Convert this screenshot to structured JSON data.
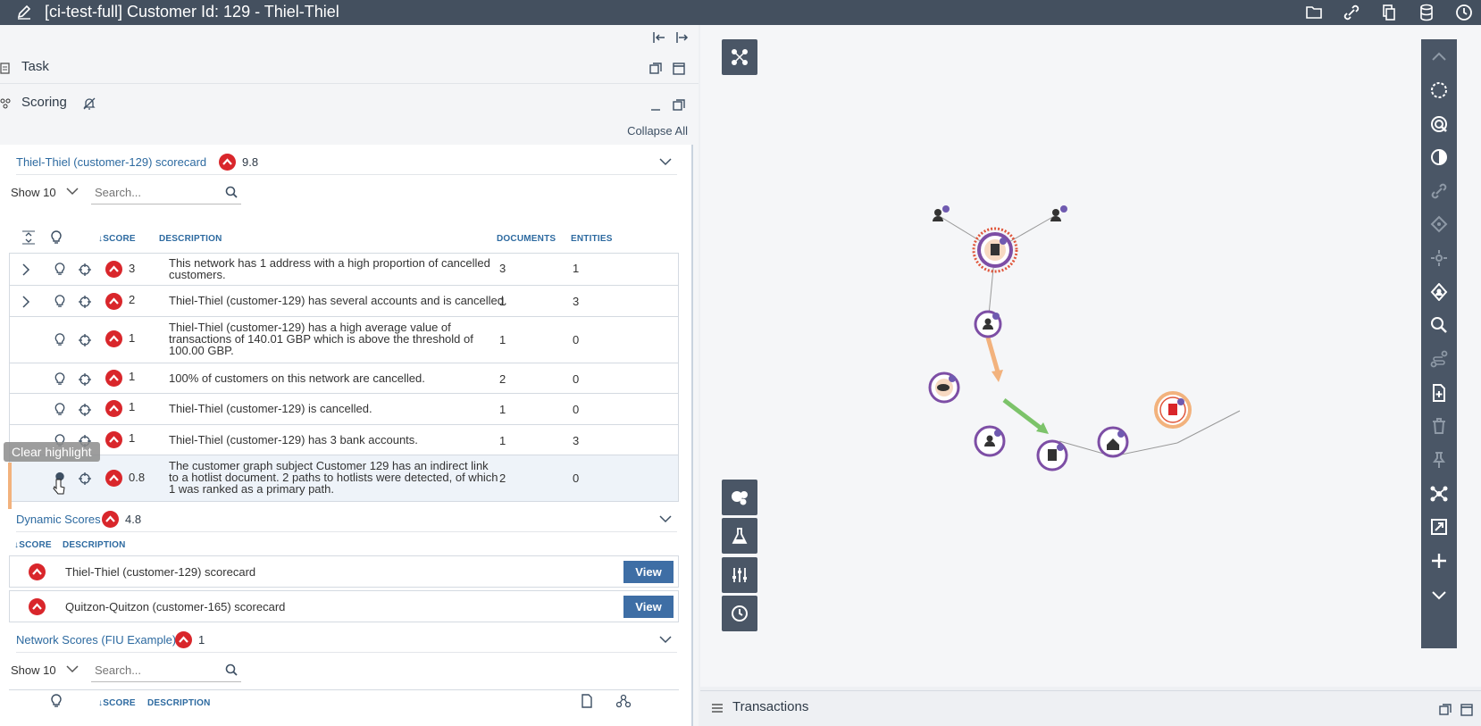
{
  "window": {
    "title": "[ci-test-full] Customer Id: 129 - Thiel-Thiel"
  },
  "panels": {
    "task": "Task",
    "scoring": "Scoring",
    "collapse_all": "Collapse All",
    "transactions": "Transactions"
  },
  "scorecard": {
    "title": "Thiel-Thiel (customer-129) scorecard",
    "score": "9.8",
    "show": "Show 10",
    "search_placeholder": "Search...",
    "columns": {
      "score": "↓SCORE",
      "description": "DESCRIPTION",
      "documents": "DOCUMENTS",
      "entities": "ENTITIES"
    },
    "rows": [
      {
        "score": "3",
        "description": "This network has 1 address with a high proportion of cancelled customers.",
        "documents": "3",
        "entities": "1"
      },
      {
        "score": "2",
        "description": "Thiel-Thiel (customer-129) has several accounts and is cancelled.",
        "documents": "1",
        "entities": "3"
      },
      {
        "score": "1",
        "description": "Thiel-Thiel (customer-129) has a high average value of transactions of 140.01 GBP which is above the threshold of 100.00 GBP.",
        "documents": "1",
        "entities": "0"
      },
      {
        "score": "1",
        "description": "100% of customers on this network are cancelled.",
        "documents": "2",
        "entities": "0"
      },
      {
        "score": "1",
        "description": "Thiel-Thiel (customer-129) is cancelled.",
        "documents": "1",
        "entities": "0"
      },
      {
        "score": "1",
        "description": "Thiel-Thiel (customer-129) has 3 bank accounts.",
        "documents": "1",
        "entities": "3"
      },
      {
        "score": "0.8",
        "description": "The customer graph subject Customer 129 has an indirect link to a hotlist document. 2 paths to hotlists were detected, of which 1 was ranked as a primary path.",
        "documents": "2",
        "entities": "0"
      }
    ]
  },
  "tooltip": "Clear highlight",
  "dynamic": {
    "title": "Dynamic Scores",
    "score": "4.8",
    "columns": {
      "score": "↓SCORE",
      "description": "DESCRIPTION"
    },
    "rows": [
      {
        "description": "Thiel-Thiel (customer-129) scorecard",
        "action": "View"
      },
      {
        "description": "Quitzon-Quitzon (customer-165) scorecard",
        "action": "View"
      }
    ]
  },
  "network": {
    "title": "Network Scores (FIU Example)",
    "score": "1",
    "show": "Show 10",
    "search_placeholder": "Search...",
    "columns": {
      "score": "↓SCORE",
      "description": "DESCRIPTION"
    }
  },
  "colors": {
    "titlebar": "#44505f",
    "badge": "#d9262b",
    "link": "#2d6aa0",
    "button": "#3e6ea5",
    "toolbar": "#4a5666"
  }
}
